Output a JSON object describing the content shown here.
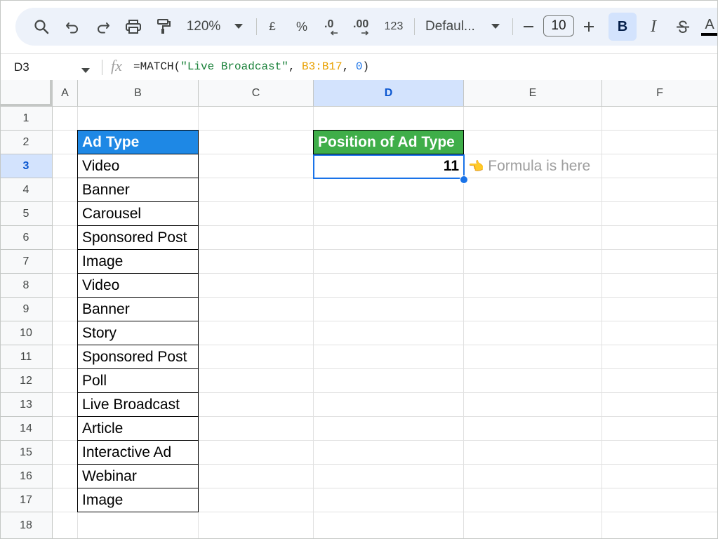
{
  "toolbar": {
    "zoom": "120%",
    "currency_symbol": "£",
    "percent_symbol": "%",
    "decrease_decimal": ".0",
    "increase_decimal": ".00",
    "number_format": "123",
    "font_name": "Defaul...",
    "font_size": "10",
    "bold_label": "B",
    "italic_label": "I",
    "underline_label": "A",
    "colors": {
      "toolbar_bg": "#edf2fa",
      "active_button_bg": "#d3e3fd"
    }
  },
  "formula_bar": {
    "cell_reference": "D3",
    "formula_prefix": "=MATCH(",
    "formula_string": "\"Live Broadcast\"",
    "formula_sep1": ", ",
    "formula_range": "B3:B17",
    "formula_sep2": ", ",
    "formula_num": "0",
    "formula_suffix": ")"
  },
  "grid": {
    "column_headers": [
      "A",
      "B",
      "C",
      "D",
      "E",
      "F"
    ],
    "row_headers": [
      "1",
      "2",
      "3",
      "4",
      "5",
      "6",
      "7",
      "8",
      "9",
      "10",
      "11",
      "12",
      "13",
      "14",
      "15",
      "16",
      "17",
      "18"
    ],
    "active_column": "D",
    "active_row": "3",
    "ad_type_header": "Ad Type",
    "ad_types": [
      "Video",
      "Banner",
      "Carousel",
      "Sponsored Post",
      "Image",
      "Video",
      "Banner",
      "Story",
      "Sponsored Post",
      "Poll",
      "Live Broadcast",
      "Article",
      "Interactive Ad",
      "Webinar",
      "Image"
    ],
    "position_header": "Position of Ad Type",
    "position_value": "11",
    "note_emoji": "👈",
    "note_text": "Formula is here",
    "colors": {
      "blue_header": "#1e88e5",
      "green_header": "#3fae49",
      "selection": "#1a73e8"
    }
  }
}
